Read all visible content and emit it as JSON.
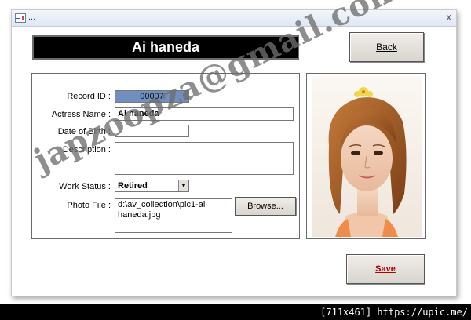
{
  "window": {
    "title": "...",
    "close_glyph": "x",
    "icon": "form-icon"
  },
  "header": {
    "name": "Ai haneda"
  },
  "buttons": {
    "back": "Back",
    "save": "Save",
    "browse": "Browse..."
  },
  "form": {
    "record_id_label": "Record ID :",
    "record_id_value": "00007",
    "actress_name_label": "Actress Name :",
    "actress_name_value": "Ai haneda",
    "dob_label": "Date of Birth :",
    "dob_value": "",
    "description_label": "Description :",
    "description_value": "",
    "work_status_label": "Work Status :",
    "work_status_value": "Retired",
    "photo_file_label": "Photo File :",
    "photo_file_value": "d:\\av_collection\\pic1-ai haneda.jpg"
  },
  "photo": {
    "description": "portrait-photo"
  },
  "watermark": {
    "text": "japzoopza@gmail.com"
  },
  "footer": {
    "text": "[711x461] https://upic.me/"
  },
  "colors": {
    "record_id_bg": "#6f8fbf",
    "save_text": "#b00000",
    "header_bg": "#000000"
  }
}
